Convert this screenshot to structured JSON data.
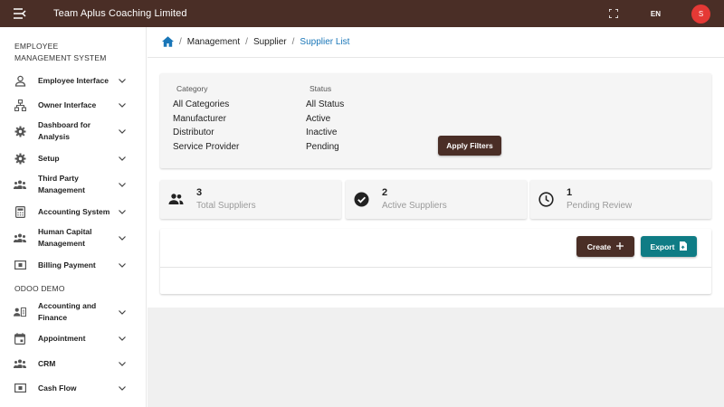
{
  "header": {
    "title": "Team Aplus Coaching Limited",
    "language": "EN",
    "avatar_initial": "S",
    "bar_color": "#4a2e26",
    "avatar_color": "#e53935",
    "icons": [
      "menu-back-icon",
      "fullscreen-icon"
    ]
  },
  "sidebar": {
    "section1_title": "EMPLOYEE MANAGEMENT SYSTEM",
    "items": [
      {
        "label": "Employee Interface",
        "icon": "person-icon"
      },
      {
        "label": "Owner Interface",
        "icon": "org-chart-icon"
      },
      {
        "label": "Dashboard for Analysis",
        "icon": "gear-icon"
      },
      {
        "label": "Setup",
        "icon": "gear-icon"
      },
      {
        "label": "Third Party Management",
        "icon": "group-icon"
      },
      {
        "label": "Accounting System",
        "icon": "calculator-icon"
      },
      {
        "label": "Human Capital Management",
        "icon": "group-icon"
      },
      {
        "label": "Billing Payment",
        "icon": "cash-icon"
      }
    ],
    "section2_title": "ODOO DEMO",
    "odoo_items": [
      {
        "label": "Accounting and Finance",
        "icon": "contact-card-icon"
      },
      {
        "label": "Appointment",
        "icon": "calendar-icon"
      },
      {
        "label": "CRM",
        "icon": "group-icon"
      },
      {
        "label": "Cash Flow",
        "icon": "cash-icon"
      }
    ]
  },
  "breadcrumb": {
    "items": [
      "Management",
      "Supplier",
      "Supplier List"
    ],
    "separator": "/",
    "active_color": "#1976b8"
  },
  "filters": {
    "category_title": "Category",
    "category_options": [
      "All Categories",
      "Manufacturer",
      "Distributor",
      "Service Provider"
    ],
    "status_title": "Status",
    "status_options": [
      "All Status",
      "Active",
      "Inactive",
      "Pending"
    ],
    "apply_label": "Apply Filters"
  },
  "stats": [
    {
      "value": "3",
      "label": "Total Suppliers",
      "icon": "group-icon"
    },
    {
      "value": "2",
      "label": "Active Suppliers",
      "icon": "check-circle-icon"
    },
    {
      "value": "1",
      "label": "Pending Review",
      "icon": "clock-icon"
    }
  ],
  "actions": {
    "create_label": "Create",
    "create_color": "#4a2e26",
    "export_label": "Export",
    "export_color": "#0f7c85"
  }
}
